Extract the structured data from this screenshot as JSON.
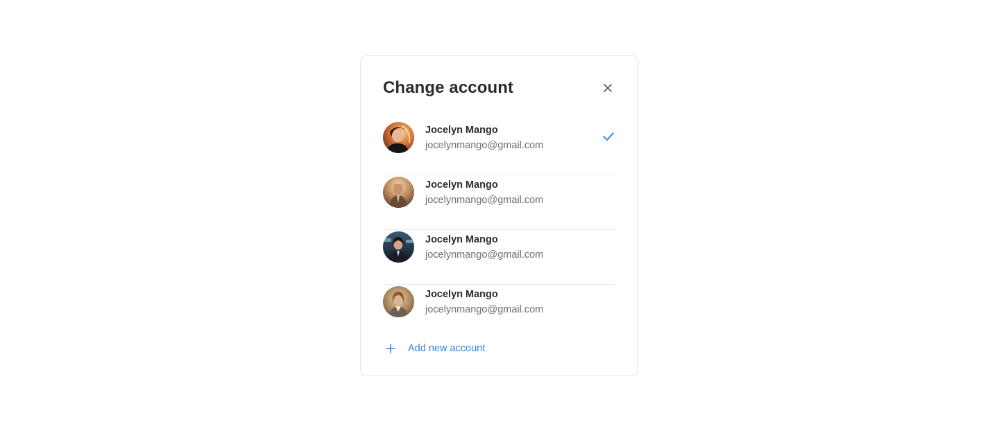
{
  "dialog": {
    "title": "Change account",
    "close_icon": "close-icon",
    "add_icon": "plus-icon",
    "add_label": "Add new account",
    "accent_color": "#2f86d3"
  },
  "accounts": [
    {
      "name": "Jocelyn Mango",
      "email": "jocelynmango@gmail.com",
      "selected": true
    },
    {
      "name": "Jocelyn Mango",
      "email": "jocelynmango@gmail.com",
      "selected": false
    },
    {
      "name": "Jocelyn Mango",
      "email": "jocelynmango@gmail.com",
      "selected": false
    },
    {
      "name": "Jocelyn Mango",
      "email": "jocelynmango@gmail.com",
      "selected": false
    }
  ]
}
